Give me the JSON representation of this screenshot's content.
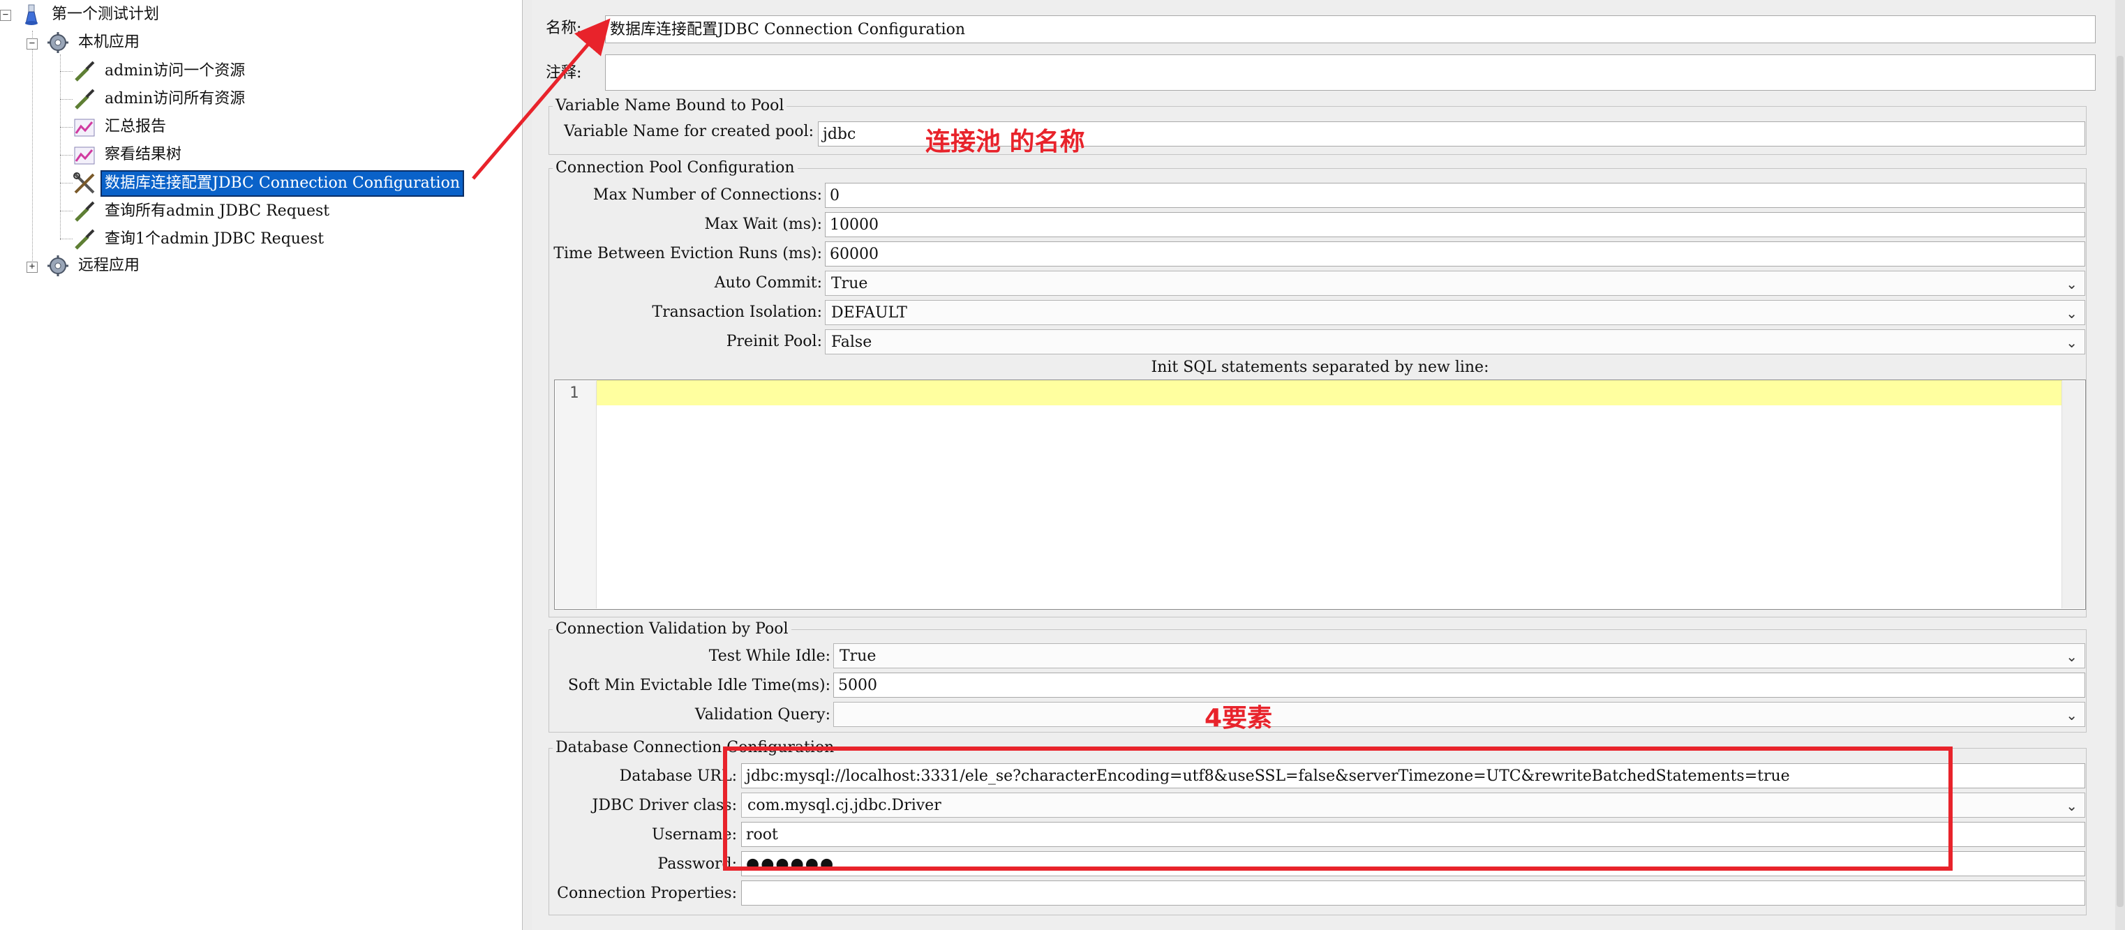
{
  "tree": {
    "items": [
      {
        "label": "第一个测试计划",
        "icon": "test-plan-flask-icon"
      },
      {
        "label": "本机应用",
        "icon": "thread-group-gear-icon"
      },
      {
        "label": "admin访问一个资源",
        "icon": "sampler-pipette-icon"
      },
      {
        "label": "admin访问所有资源",
        "icon": "sampler-pipette-icon"
      },
      {
        "label": "汇总报告",
        "icon": "listener-chart-icon"
      },
      {
        "label": "察看结果树",
        "icon": "listener-chart-icon"
      },
      {
        "label": "数据库连接配置JDBC Connection Configuration",
        "icon": "config-tools-icon"
      },
      {
        "label": "查询所有admin JDBC Request",
        "icon": "sampler-pipette-icon"
      },
      {
        "label": "查询1个admin JDBC Request",
        "icon": "sampler-pipette-icon"
      },
      {
        "label": "远程应用",
        "icon": "thread-group-gear-icon"
      }
    ]
  },
  "form": {
    "name_label": "名称:",
    "name_value": "数据库连接配置JDBC Connection Configuration",
    "comment_label": "注释:",
    "comment_value": "",
    "var_group": {
      "title": "Variable Name Bound to Pool",
      "var_label": "Variable Name for created pool:",
      "var_value": "jdbc"
    },
    "pool_group": {
      "title": "Connection Pool Configuration",
      "max_conn_label": "Max Number of Connections:",
      "max_conn_value": "0",
      "max_wait_label": "Max Wait (ms):",
      "max_wait_value": "10000",
      "eviction_label": "Time Between Eviction Runs (ms):",
      "eviction_value": "60000",
      "auto_commit_label": "Auto Commit:",
      "auto_commit_value": "True",
      "isolation_label": "Transaction Isolation:",
      "isolation_value": "DEFAULT",
      "preinit_label": "Preinit Pool:",
      "preinit_value": "False",
      "init_sql_label": "Init SQL statements separated by new line:",
      "line_number": "1"
    },
    "validation_group": {
      "title": "Connection Validation by Pool",
      "test_idle_label": "Test While Idle:",
      "test_idle_value": "True",
      "soft_min_label": "Soft Min Evictable Idle Time(ms):",
      "soft_min_value": "5000",
      "query_label": "Validation Query:",
      "query_value": ""
    },
    "db_group": {
      "title": "Database Connection Configuration",
      "url_label": "Database URL:",
      "url_value": "jdbc:mysql://localhost:3331/ele_se?characterEncoding=utf8&useSSL=false&serverTimezone=UTC&rewriteBatchedStatements=true",
      "driver_label": "JDBC Driver class:",
      "driver_value": "com.mysql.cj.jdbc.Driver",
      "username_label": "Username:",
      "username_value": "root",
      "password_label": "Password:",
      "password_value": "●●●●●●",
      "props_label": "Connection Properties:",
      "props_value": ""
    }
  },
  "annotations": {
    "pool_name_note": "连接池  的名称",
    "four_elements_note": "4要素",
    "color": "#e8232b"
  },
  "colors": {
    "selection": "#0a62c9",
    "editor_highlight": "#ffff9f",
    "panel_bg": "#eeeeee"
  }
}
